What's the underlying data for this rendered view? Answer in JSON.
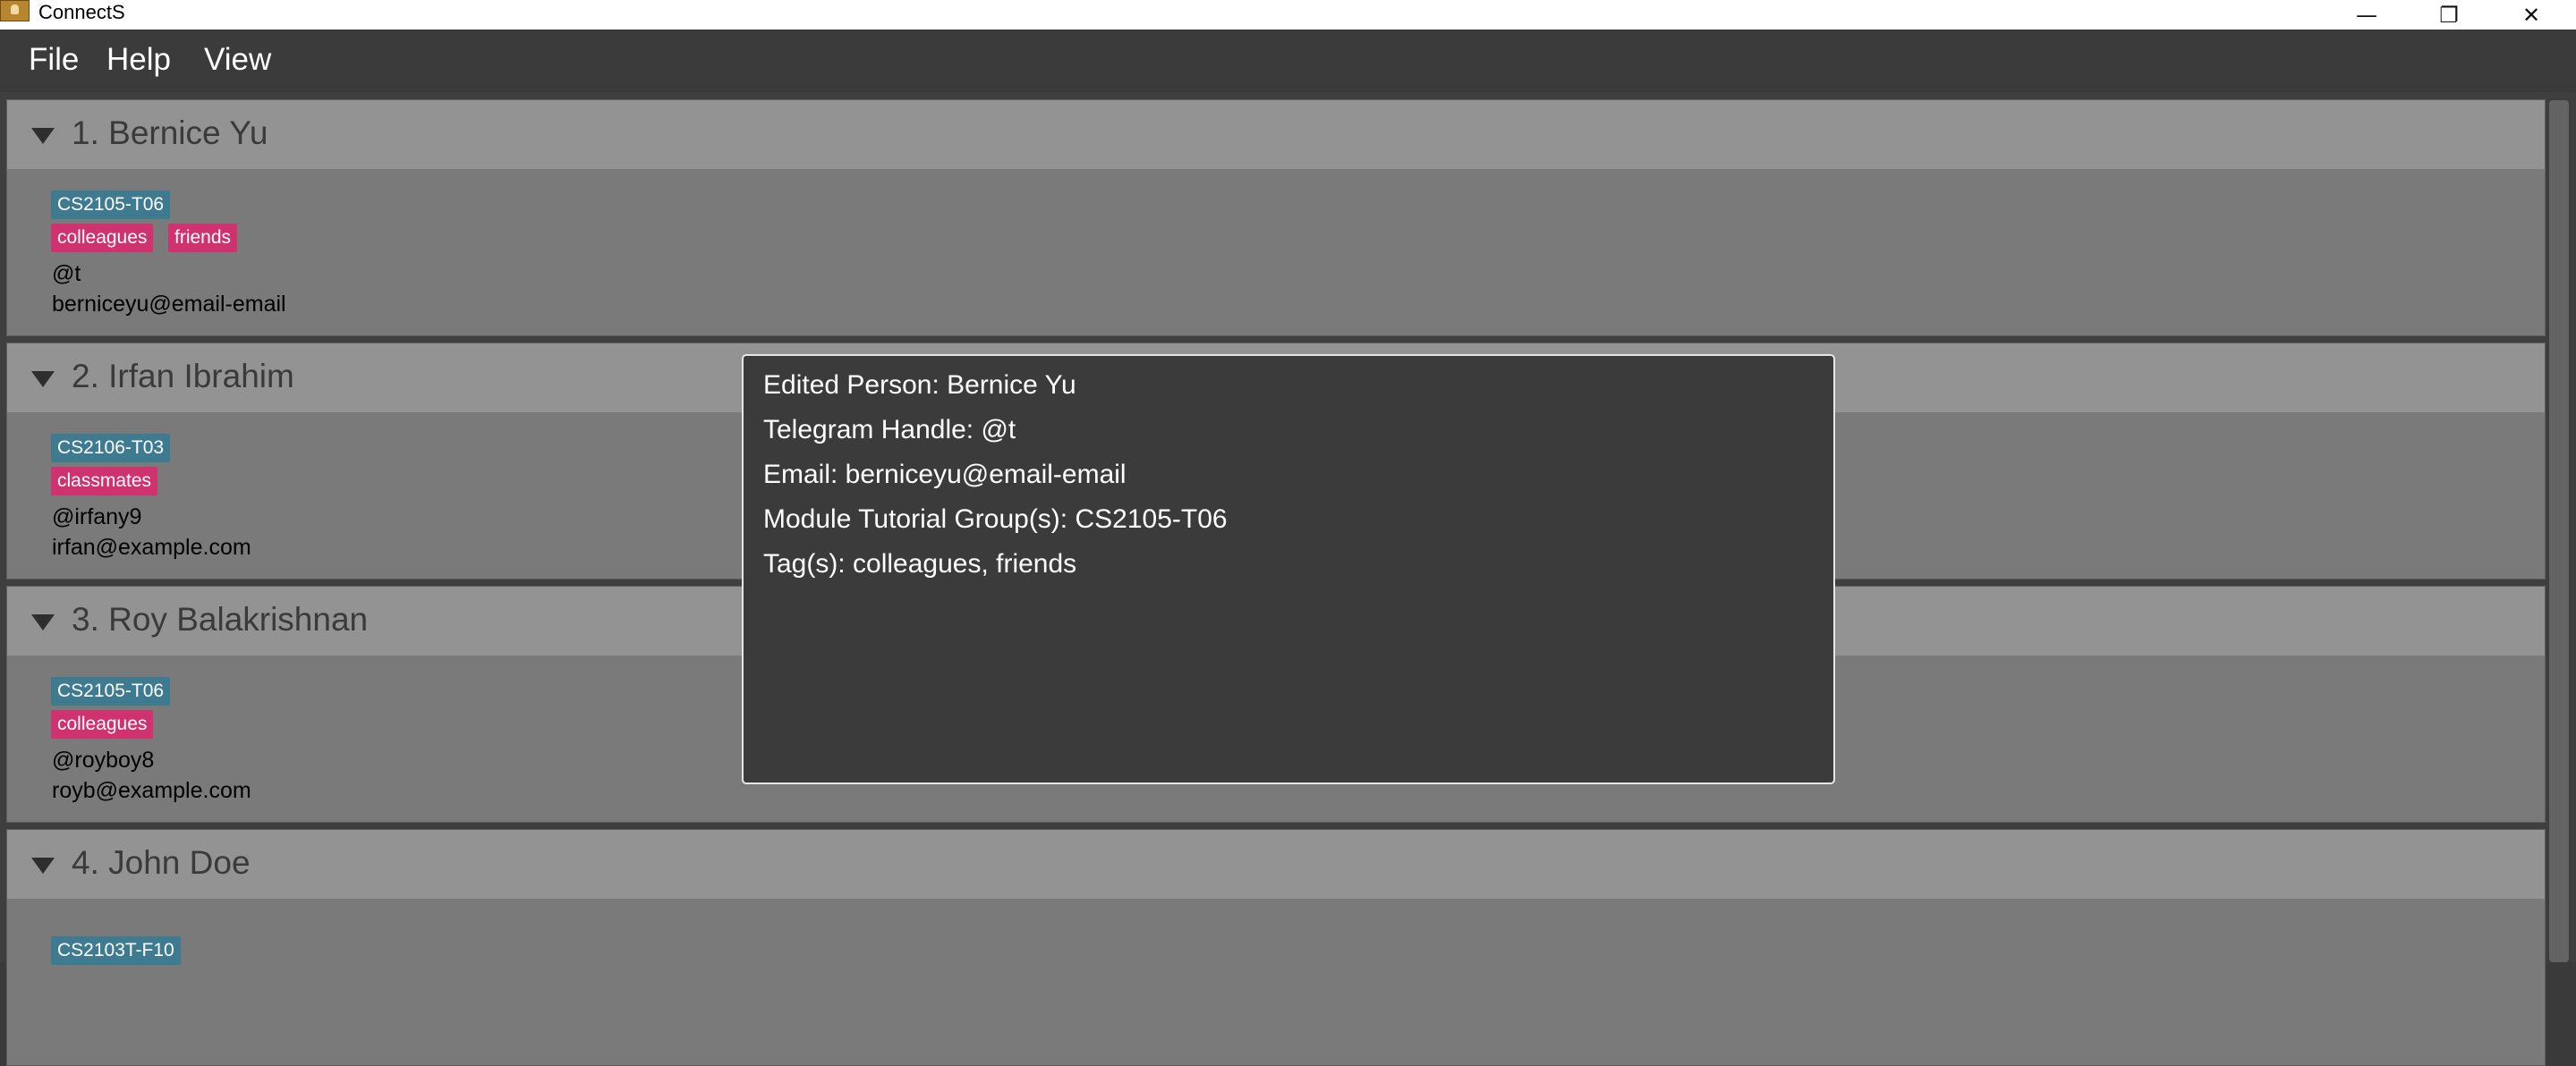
{
  "window": {
    "title": "ConnectS",
    "minimize_glyph": "—",
    "maximize_glyph": "❐",
    "close_glyph": "✕"
  },
  "menu": {
    "items": [
      "File",
      "Help",
      "View"
    ]
  },
  "persons": [
    {
      "name": "1. Bernice Yu",
      "module": "CS2105-T06",
      "tags": [
        "colleagues",
        "friends"
      ],
      "telegram": "@t",
      "email": "berniceyu@email-email"
    },
    {
      "name": "2. Irfan Ibrahim",
      "module": "CS2106-T03",
      "tags": [
        "classmates"
      ],
      "telegram": "@irfany9",
      "email": "irfan@example.com"
    },
    {
      "name": "3. Roy Balakrishnan",
      "module": "CS2105-T06",
      "tags": [
        "colleagues"
      ],
      "telegram": "@royboy8",
      "email": "royb@example.com"
    },
    {
      "name": "4. John Doe",
      "module": "CS2103T-F10",
      "tags": [],
      "telegram": "",
      "email": ""
    }
  ],
  "popup": {
    "lines": [
      "Edited Person: Bernice Yu",
      "Telegram Handle: @t",
      "Email: berniceyu@email-email",
      "Module Tutorial Group(s): CS2105-T06",
      "Tag(s): colleagues, friends"
    ]
  },
  "colors": {
    "module_chip": "#3e7b91",
    "tag_chip": "#d0316f",
    "card_body": "#7a7a7a",
    "card_header": "#939393",
    "background": "#3b3b3b"
  },
  "icons": {
    "app": "app-icon",
    "expand": "triangle-down-icon"
  }
}
